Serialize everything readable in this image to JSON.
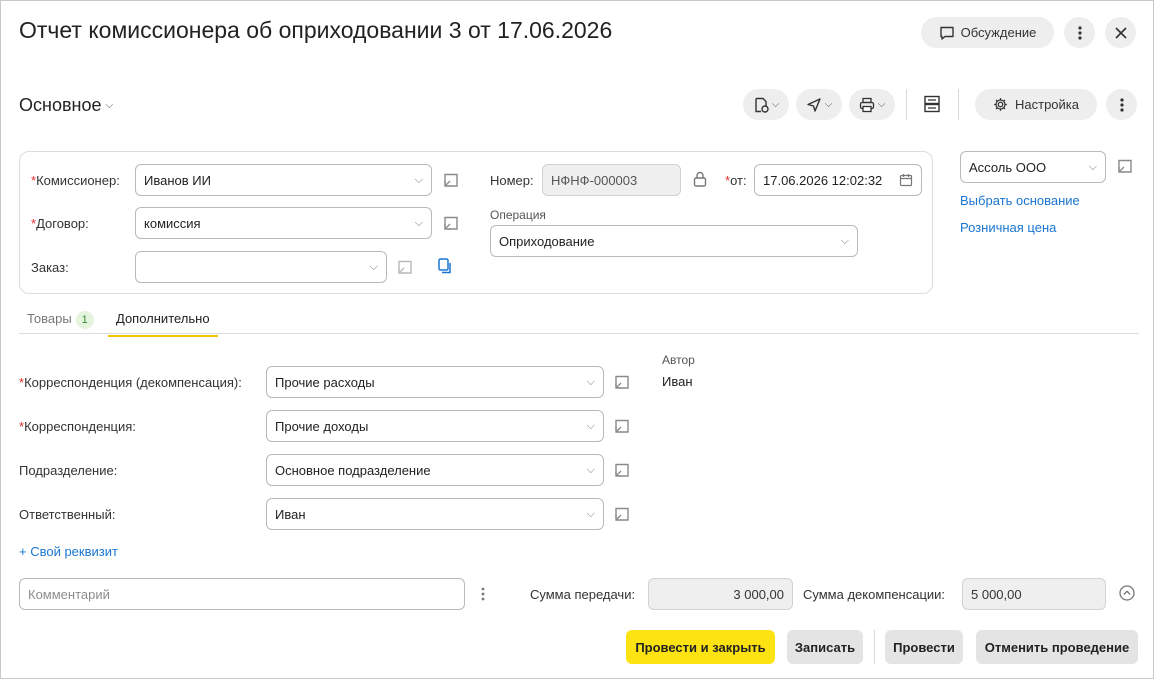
{
  "window": {
    "title": "Отчет комиссионера об оприходовании 3 от 17.06.2026",
    "discussion_label": "Обсуждение"
  },
  "toolbar": {
    "form_name": "Основное",
    "settings_label": "Настройка"
  },
  "header": {
    "commissioner": {
      "label": "Комиссионер:",
      "value": "Иванов ИИ"
    },
    "contract": {
      "label": "Договор:",
      "value": "комиссия"
    },
    "order": {
      "label": "Заказ:",
      "value": ""
    },
    "number": {
      "label": "Номер:",
      "value": "НФНФ-000003"
    },
    "date": {
      "label": "от:",
      "value": "17.06.2026 12:02:32"
    },
    "operation": {
      "label": "Операция",
      "value": "Оприходование"
    },
    "organization": {
      "value": "Ассоль ООО"
    },
    "select_basis_link": "Выбрать основание",
    "retail_price_link": "Розничная цена",
    "required_mark": "*"
  },
  "tabs": [
    {
      "label": "Товары",
      "badge": "1"
    },
    {
      "label": "Дополнительно"
    }
  ],
  "additional": {
    "corr_decomp": {
      "label": "Корреспонденция (декомпенсация):",
      "value": "Прочие расходы"
    },
    "corr": {
      "label": "Корреспонденция:",
      "value": "Прочие доходы"
    },
    "department": {
      "label": "Подразделение:",
      "value": "Основное подразделение"
    },
    "responsible": {
      "label": "Ответственный:",
      "value": "Иван"
    },
    "author_label": "Автор",
    "author_value": "Иван",
    "custom_attr_link": "+ Свой реквизит"
  },
  "footer": {
    "comment_placeholder": "Комментарий",
    "transfer_sum_label": "Сумма передачи:",
    "transfer_sum_value": "3 000,00",
    "decomp_sum_label": "Сумма декомпенсации:",
    "decomp_sum_value": "5 000,00"
  },
  "actions": {
    "post_close": "Провести и закрыть",
    "save": "Записать",
    "post": "Провести",
    "cancel_post": "Отменить проведение"
  },
  "colors": {
    "primary_button": "#fce311",
    "link": "#1976d2",
    "required": "#e0302b",
    "tab_active_underline": "#f5c400"
  }
}
